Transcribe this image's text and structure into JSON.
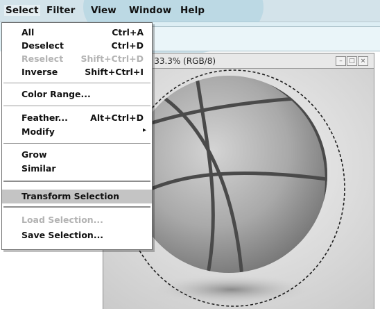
{
  "menubar": {
    "items": [
      "Select",
      "Filter",
      "View",
      "Window",
      "Help"
    ]
  },
  "document": {
    "title": "e 33.3% (RGB/8)",
    "buttons": {
      "minimize": "–",
      "maximize": "□",
      "close": "×"
    }
  },
  "select_menu": {
    "all": {
      "label": "All",
      "shortcut": "Ctrl+A"
    },
    "deselect": {
      "label": "Deselect",
      "shortcut": "Ctrl+D"
    },
    "reselect": {
      "label": "Reselect",
      "shortcut": "Shift+Ctrl+D"
    },
    "inverse": {
      "label": "Inverse",
      "shortcut": "Shift+Ctrl+I"
    },
    "color_range": {
      "label": "Color Range..."
    },
    "feather": {
      "label": "Feather...",
      "shortcut": "Alt+Ctrl+D"
    },
    "modify": {
      "label": "Modify"
    },
    "grow": {
      "label": "Grow"
    },
    "similar": {
      "label": "Similar"
    },
    "transform_selection": {
      "label": "Transform Selection"
    },
    "load_selection": {
      "label": "Load Selection..."
    },
    "save_selection": {
      "label": "Save Selection..."
    }
  },
  "colors": {
    "menubar_bg": "#d3e3ea",
    "highlight": "#c4c4c4",
    "disabled_text": "#b3b3b3"
  }
}
